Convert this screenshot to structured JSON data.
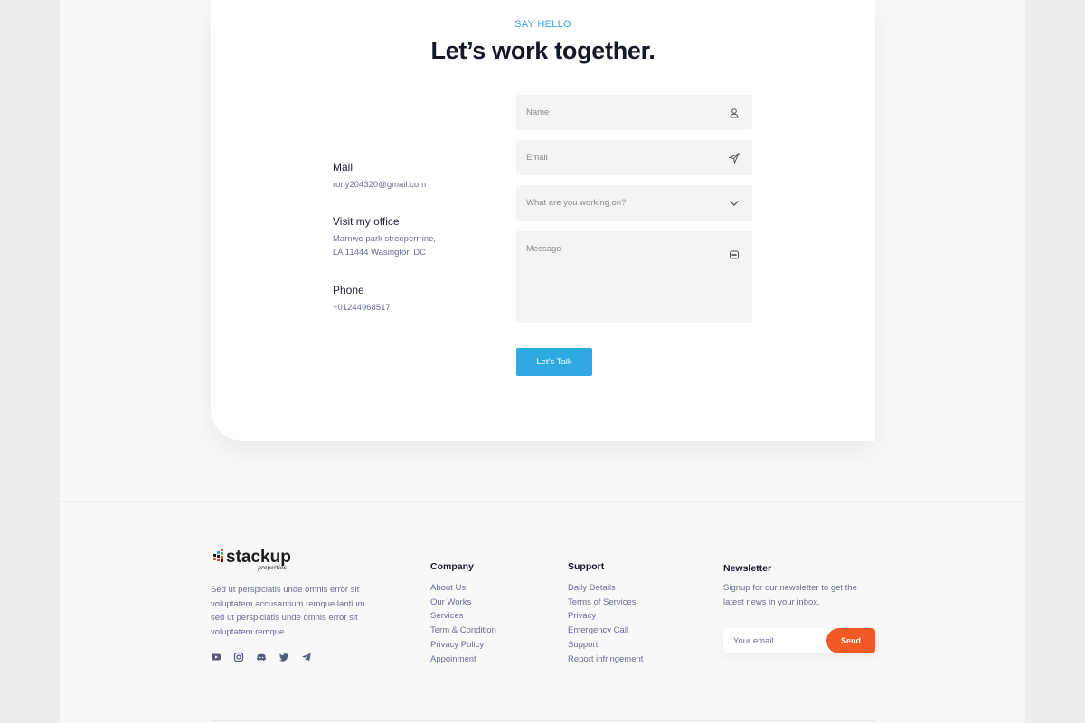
{
  "contact": {
    "eyebrow": "SAY HELLO",
    "headline": "Let’s work together.",
    "info": [
      {
        "title": "Mail",
        "lines": [
          "rony204320@gmail.com"
        ]
      },
      {
        "title": "Visit my office",
        "lines": [
          "Marnwe park streeperrrine,",
          "LA 11444 Wasington DC"
        ]
      },
      {
        "title": "Phone",
        "lines": [
          "+01244968517"
        ]
      }
    ],
    "form": {
      "name_placeholder": "Name",
      "email_placeholder": "Email",
      "topic_placeholder": "What are you working on?",
      "message_placeholder": "Message",
      "submit_label": "Let’s Talk"
    }
  },
  "footer": {
    "logo": {
      "text_main": "stackup",
      "text_sub": "properties",
      "colors": [
        "#1b1b1b",
        "#f15a24"
      ]
    },
    "description": "Sed ut perspiciatis unde omnis error sit voluptatem accusantium remque lantium sed ut perspiciatis unde omnis error sit voluptatem remque.",
    "socials": [
      "youtube-icon",
      "instagram-icon",
      "discord-icon",
      "twitter-icon",
      "telegram-icon"
    ],
    "company": {
      "title": "Company",
      "links": [
        "About Us",
        "Our Works",
        "Services",
        "Term & Condition",
        "Privacy Policy",
        "Appoinment"
      ]
    },
    "support": {
      "title": "Support",
      "links": [
        "Daily Details",
        "Terms of Services",
        "Privacy",
        "Emergency Call",
        "Support",
        "Report infringement"
      ]
    },
    "newsletter": {
      "title": "Newsletter",
      "text": "Signup for our newsletter to get the latest news in your inbox.",
      "email_placeholder": "Your email",
      "send_label": "Send"
    }
  },
  "colors": {
    "accent_blue": "#2ea9e1",
    "accent_orange": "#f15a24",
    "text_dark": "#151827",
    "text_muted": "#6a6d90"
  }
}
